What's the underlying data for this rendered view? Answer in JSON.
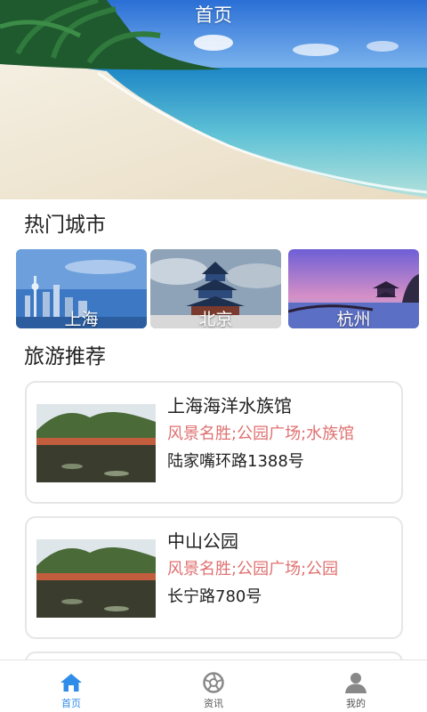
{
  "header": {
    "title": "首页"
  },
  "sections": {
    "hot_cities": "热门城市",
    "recommend": "旅游推荐"
  },
  "cities": [
    {
      "name": "上海"
    },
    {
      "name": "北京"
    },
    {
      "name": "杭州"
    }
  ],
  "recommendations": [
    {
      "name": "上海海洋水族馆",
      "tags": "风景名胜;公园广场;水族馆",
      "address": "陆家嘴环路1388号"
    },
    {
      "name": "中山公园",
      "tags": "风景名胜;公园广场;公园",
      "address": "长宁路780号"
    }
  ],
  "tabs": [
    {
      "label": "首页",
      "icon": "home-icon"
    },
    {
      "label": "资讯",
      "icon": "aperture-icon"
    },
    {
      "label": "我的",
      "icon": "user-icon"
    }
  ],
  "colors": {
    "accent": "#2f8ce8",
    "tag_text": "#e07070",
    "card_border": "#e6e6e6",
    "inactive_icon": "#888888"
  }
}
